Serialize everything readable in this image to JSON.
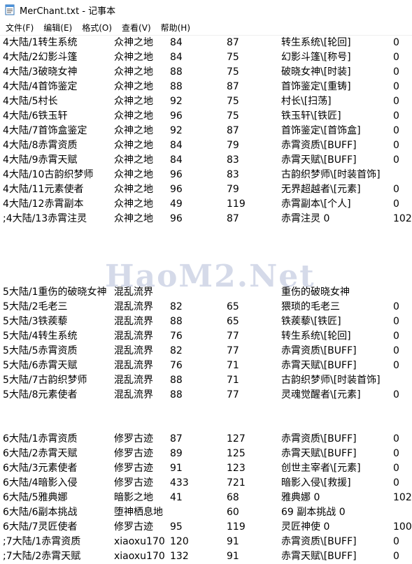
{
  "window": {
    "title": "MerChant.txt - 记事本"
  },
  "menu": [
    {
      "label": "文件(F)"
    },
    {
      "label": "编辑(E)"
    },
    {
      "label": "格式(O)"
    },
    {
      "label": "查看(V)"
    },
    {
      "label": "帮助(H)"
    }
  ],
  "watermark": "HaoM2.Net",
  "lines": [
    [
      "4大陆/1转生系统",
      "众神之地",
      "84",
      "87",
      "转生系统\\[轮回]",
      "0"
    ],
    [
      "4大陆/2幻影斗篷",
      "众神之地",
      "84",
      "75",
      "幻影斗篷\\[称号]",
      "0"
    ],
    [
      "4大陆/3破晓女神",
      "众神之地",
      "88",
      "75",
      "破晓女神\\[时装]",
      "0"
    ],
    [
      "4大陆/4首饰鉴定",
      "众神之地",
      "88",
      "87",
      "首饰鉴定\\[重铸]",
      "0"
    ],
    [
      "4大陆/5村长",
      "众神之地",
      "92",
      "75",
      "村长\\[扫荡]",
      "0"
    ],
    [
      "4大陆/6铁玉轩",
      "众神之地",
      "96",
      "75",
      "铁玉轩\\[铁匠]",
      "0"
    ],
    [
      "4大陆/7首饰盒鉴定",
      "众神之地",
      "92",
      "87",
      "首饰鉴定\\[首饰盒]",
      "0"
    ],
    [
      "4大陆/8赤霄资质",
      "众神之地",
      "84",
      "79",
      "赤霄资质\\[BUFF]",
      "0"
    ],
    [
      "4大陆/9赤霄天赋",
      "众神之地",
      "84",
      "83",
      "赤霄天赋\\[BUFF]",
      "0"
    ],
    [
      "4大陆/10古韵织梦师",
      "众神之地",
      "96",
      "83",
      "古韵织梦师\\[时装首饰]",
      ""
    ],
    [
      "4大陆/11元素使者",
      "众神之地",
      "96",
      "79",
      "无界超越者\\[元素]",
      "0"
    ],
    [
      "4大陆/12赤霄副本",
      "众神之地",
      "49",
      "119",
      "赤霄副本\\[个人]",
      "0"
    ],
    [
      ";4大陆/13赤霄注灵",
      "众神之地",
      "96",
      "87",
      "赤霄注灵   0",
      "102"
    ],
    [
      "",
      "",
      "",
      "",
      "",
      ""
    ],
    [
      "",
      "",
      "",
      "",
      "",
      ""
    ],
    [
      "",
      "",
      "",
      "",
      "",
      ""
    ],
    [
      "",
      "",
      "",
      "",
      "",
      ""
    ],
    [
      "5大陆/1重伤的破晓女神",
      "混乱流界",
      "",
      "",
      "重伤的破晓女神",
      ""
    ],
    [
      "5大陆/2毛老三",
      "混乱流界",
      "82",
      "65",
      "猥琐的毛老三",
      "0"
    ],
    [
      "5大陆/3铁蒺藜",
      "混乱流界",
      "88",
      "65",
      "铁蒺藜\\[铁匠]",
      "0"
    ],
    [
      "5大陆/4转生系统",
      "混乱流界",
      "76",
      "77",
      "转生系统\\[轮回]",
      "0"
    ],
    [
      "5大陆/5赤霄资质",
      "混乱流界",
      "82",
      "77",
      "赤霄资质\\[BUFF]",
      "0"
    ],
    [
      "5大陆/6赤霄天赋",
      "混乱流界",
      "76",
      "71",
      "赤霄天赋\\[BUFF]",
      "0"
    ],
    [
      "5大陆/7古韵织梦师",
      "混乱流界",
      "88",
      "71",
      "古韵织梦师\\[时装首饰]",
      ""
    ],
    [
      "5大陆/8元素使者",
      "混乱流界",
      "88",
      "77",
      "灵魂觉醒者\\[元素]",
      "0"
    ],
    [
      "",
      "",
      "",
      "",
      "",
      ""
    ],
    [
      "",
      "",
      "",
      "",
      "",
      ""
    ],
    [
      "6大陆/1赤霄资质",
      "修罗古迹",
      "87",
      "127",
      "赤霄资质\\[BUFF]",
      "0"
    ],
    [
      "6大陆/2赤霄天赋",
      "修罗古迹",
      "89",
      "125",
      "赤霄天赋\\[BUFF]",
      "0"
    ],
    [
      "6大陆/3元素使者",
      "修罗古迹",
      "91",
      "123",
      "创世主宰者\\[元素]",
      "0"
    ],
    [
      "6大陆/4暗影入侵",
      "修罗古迹",
      "433",
      "721",
      "暗影入侵\\[救援]",
      "0"
    ],
    [
      "6大陆/5雅典娜",
      "暗影之地",
      "41",
      "68",
      "雅典娜      0",
      "102"
    ],
    [
      "6大陆/6副本挑战",
      "堕神栖息地",
      "",
      "60",
      "69         副本挑战    0",
      ""
    ],
    [
      "6大陆/7灵匠使者",
      "修罗古迹",
      "95",
      "119",
      "灵匠神使     0",
      "100"
    ],
    [
      ";7大陆/1赤霄资质",
      "xiaoxu170",
      "120",
      "91",
      "赤霄资质\\[BUFF]",
      "0"
    ],
    [
      ";7大陆/2赤霄天赋",
      "xiaoxu170",
      "132",
      "91",
      "赤霄天赋\\[BUFF]",
      "0"
    ]
  ]
}
